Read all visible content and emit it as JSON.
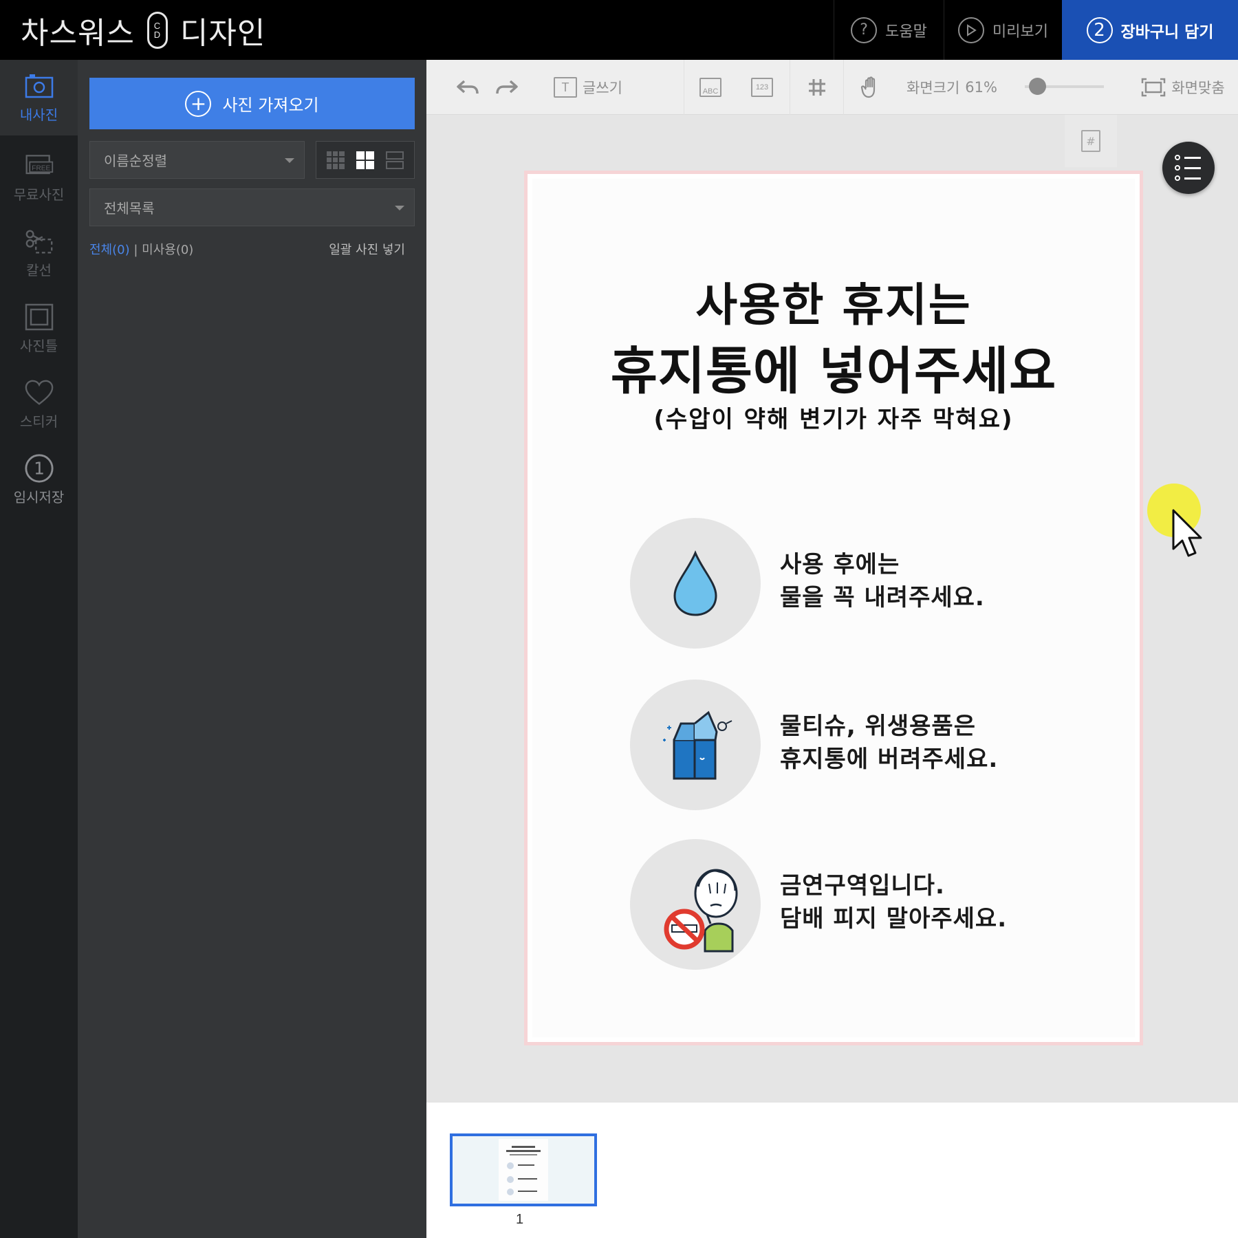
{
  "header": {
    "brand_left": "차스워스",
    "brand_logo_top": "C",
    "brand_logo_bottom": "D",
    "brand_right": "디자인",
    "help_label": "도움말",
    "preview_label": "미리보기",
    "cart_step": "2",
    "cart_label": "장바구니 담기"
  },
  "rail": {
    "items": [
      {
        "label": "내사진",
        "icon": "camera-icon",
        "active": true
      },
      {
        "label": "무료사진",
        "icon": "free-photo-icon",
        "badge": "FREE"
      },
      {
        "label": "칼선",
        "icon": "scissors-icon"
      },
      {
        "label": "사진틀",
        "icon": "frame-icon"
      },
      {
        "label": "스티커",
        "icon": "heart-icon"
      },
      {
        "label": "임시저장",
        "icon": "save-slot-icon",
        "slot": "1"
      }
    ]
  },
  "panel": {
    "import_label": "사진 가져오기",
    "sort_value": "이름순정렬",
    "folder_value": "전체목록",
    "filter_all": "전체(0)",
    "filter_sep": " | ",
    "filter_unused": "미사용(0)",
    "bulk_insert": "일괄 사진 넣기"
  },
  "toolbar": {
    "text_tool": "글쓰기",
    "abc_label": "ABC",
    "num_label": "123",
    "zoom_label": "화면크기",
    "zoom_value": "61%",
    "zoom_fraction": 0.1,
    "fit_label": "화면맞춤",
    "page_tab": "#"
  },
  "poster": {
    "title_line1": "사용한 휴지는",
    "title_line2": "휴지통에 넣어주세요",
    "subtitle": "(수압이 약해 변기가 자주 막혀요)",
    "items": [
      {
        "icon": "water-drop-icon",
        "line1": "사용 후에는",
        "line2": "물을 꼭 내려주세요."
      },
      {
        "icon": "trash-bin-icon",
        "line1": "물티슈, 위생용품은",
        "line2": "휴지통에 버려주세요."
      },
      {
        "icon": "no-smoking-icon",
        "line1": "금연구역입니다.",
        "line2": "담배 피지 말아주세요."
      }
    ]
  },
  "thumbs": {
    "page_number": "1"
  },
  "colors": {
    "accent": "#3f7fe6",
    "cart": "#1a50b4",
    "drop": "#6ec1ec",
    "bin": "#1f75c2"
  }
}
